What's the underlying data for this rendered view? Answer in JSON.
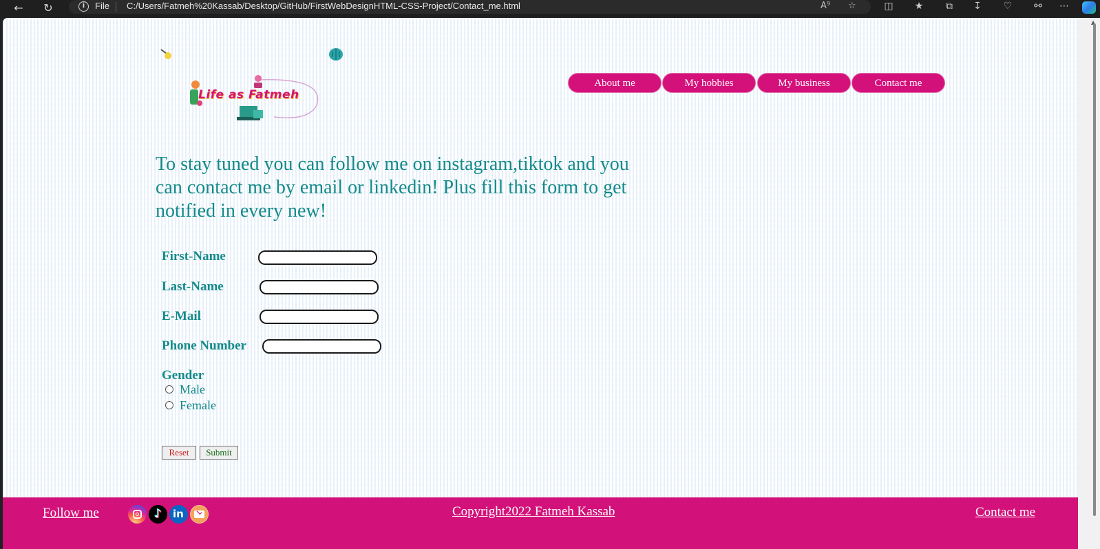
{
  "browser": {
    "protocol_label": "File",
    "url": "C:/Users/Fatmeh%20Kassab/Desktop/GitHub/FirstWebDesignHTML-CSS-Project/Contact_me.html"
  },
  "logo": {
    "text": "Life as Fatmeh"
  },
  "nav": {
    "items": [
      {
        "label": "About me"
      },
      {
        "label": "My hobbies"
      },
      {
        "label": "My business"
      },
      {
        "label": "Contact me"
      }
    ]
  },
  "intro": {
    "text": "To stay tuned you can follow me on instagram,tiktok and you can contact me by email or linkedin! Plus fill this form to get notified in every new!"
  },
  "form": {
    "first_name_label": "First-Name",
    "last_name_label": "Last-Name",
    "email_label": "E-Mail",
    "phone_label": "Phone Number",
    "gender_label": "Gender",
    "gender_options": [
      "Male",
      "Female"
    ],
    "reset_label": "Reset",
    "submit_label": "Submit"
  },
  "footer": {
    "follow_label": "Follow me",
    "copyright": "Copyright2022 Fatmeh Kassab",
    "contact_label": "Contact me"
  },
  "colors": {
    "accent": "#d4117b",
    "text_teal": "#148a8a",
    "reset_text": "#cc1a1a",
    "submit_text": "#1a6b1a"
  }
}
